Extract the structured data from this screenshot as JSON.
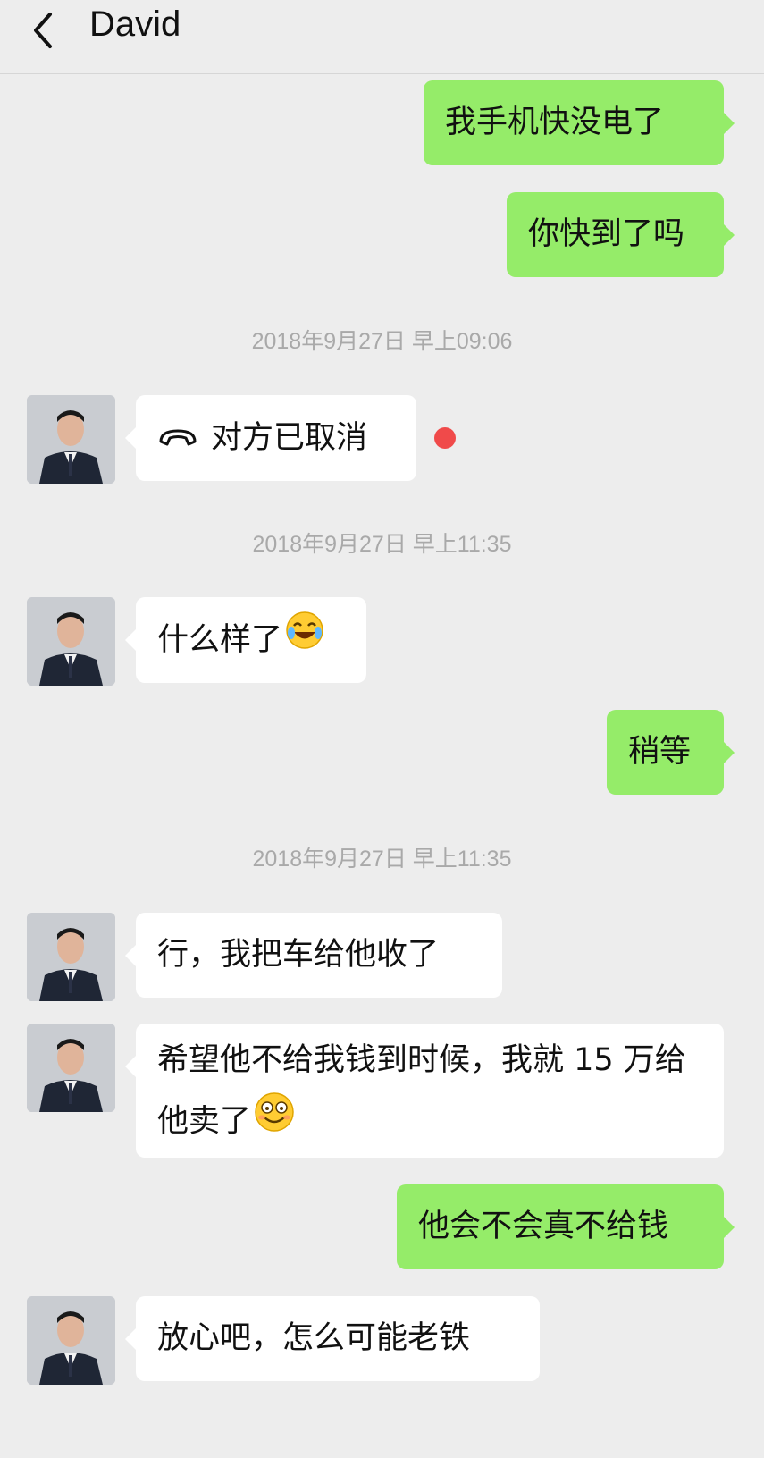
{
  "header": {
    "title": "David",
    "back_icon": "chevron-left-icon"
  },
  "timestamps": [
    "2018年9月27日 早上09:06",
    "2018年9月27日 早上11:35",
    "2018年9月27日 早上11:35"
  ],
  "messages": [
    {
      "side": "out",
      "text": "我手机快没电了"
    },
    {
      "side": "out",
      "text": "你快到了吗"
    },
    {
      "side": "in",
      "text": "对方已取消",
      "icon": "hang-up-phone-icon",
      "unread_dot_color": "#f04a4a"
    },
    {
      "side": "in",
      "text": "什么样了",
      "emoji": "tears-of-joy-emoji"
    },
    {
      "side": "out",
      "text": "稍等"
    },
    {
      "side": "in",
      "text": "行，我把车给他收了"
    },
    {
      "side": "in",
      "text": "希望他不给我钱到时候，我就 15 万给他卖了",
      "emoji": "grinning-emoji"
    },
    {
      "side": "out",
      "text": "他会不会真不给钱"
    },
    {
      "side": "in",
      "text": "放心吧，怎么可能老铁"
    }
  ],
  "colors": {
    "background": "#ededed",
    "outgoing_bubble": "#95ec69",
    "incoming_bubble": "#ffffff",
    "timestamp_text": "#a9a9a9"
  }
}
